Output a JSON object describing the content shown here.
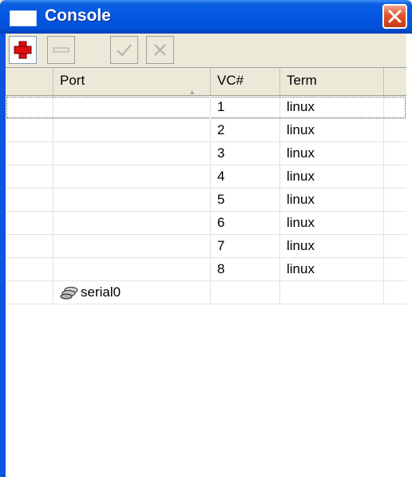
{
  "window": {
    "title": "Console",
    "icon": "window-icon",
    "close_icon": "close-icon"
  },
  "toolbar": {
    "buttons": [
      {
        "name": "add",
        "icon": "plus-icon",
        "enabled": true,
        "color": "#e01010"
      },
      {
        "name": "remove",
        "icon": "minus-icon",
        "enabled": false
      },
      {
        "name": "enable",
        "icon": "check-icon",
        "enabled": false
      },
      {
        "name": "disable",
        "icon": "x-icon",
        "enabled": false
      }
    ]
  },
  "table": {
    "columns": [
      "",
      "Port",
      "VC#",
      "Term",
      ""
    ],
    "sort_column": "Port",
    "sort_direction": "ascending",
    "rows": [
      {
        "port": "",
        "vc": "1",
        "term": "linux",
        "selected": true
      },
      {
        "port": "",
        "vc": "2",
        "term": "linux"
      },
      {
        "port": "",
        "vc": "3",
        "term": "linux"
      },
      {
        "port": "",
        "vc": "4",
        "term": "linux"
      },
      {
        "port": "",
        "vc": "5",
        "term": "linux"
      },
      {
        "port": "",
        "vc": "6",
        "term": "linux"
      },
      {
        "port": "",
        "vc": "7",
        "term": "linux"
      },
      {
        "port": "",
        "vc": "8",
        "term": "linux"
      },
      {
        "port": "serial0",
        "vc": "",
        "term": "",
        "port_icon": "serial-port-icon"
      }
    ]
  }
}
